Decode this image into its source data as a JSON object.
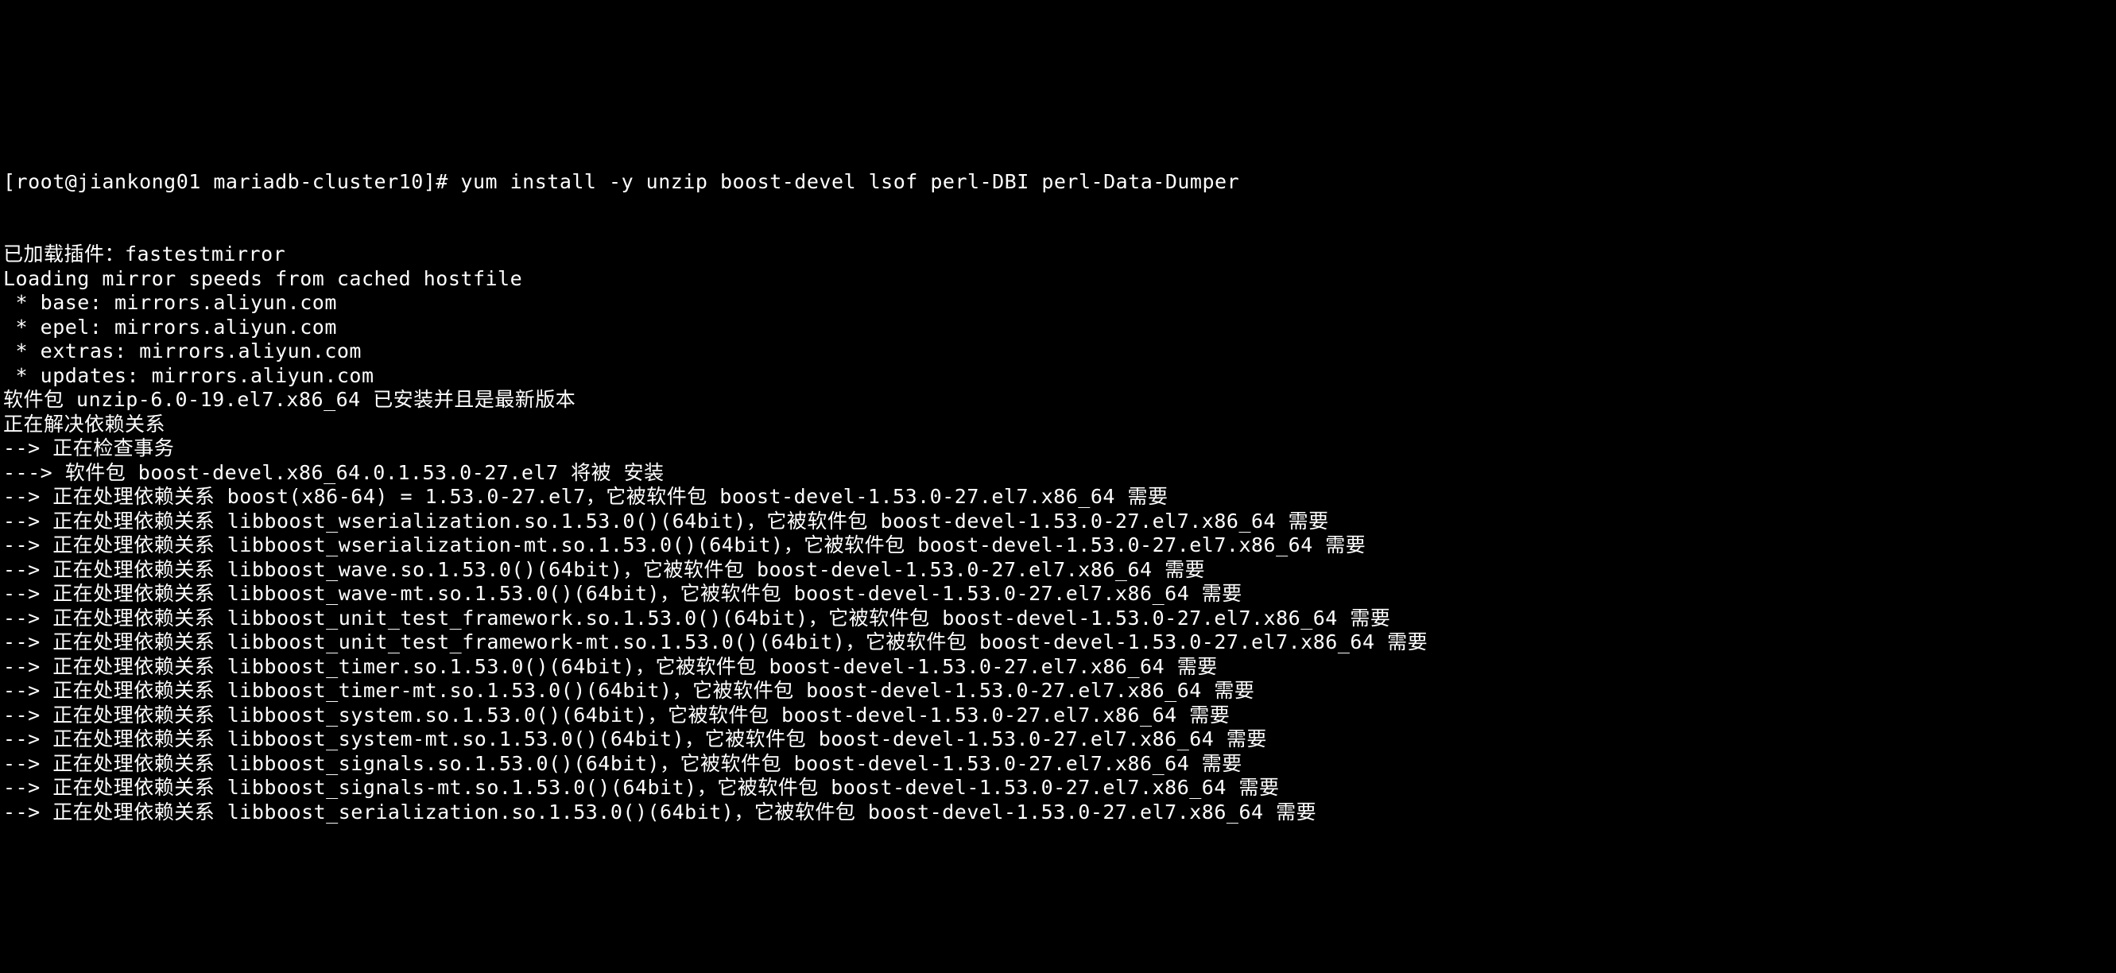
{
  "prompt_prefix": "[root@jiankong01 mariadb-cluster10]# ",
  "command": "yum install -y unzip boost-devel lsof perl-DBI perl-Data-Dumper",
  "lines": [
    "已加载插件：fastestmirror",
    "Loading mirror speeds from cached hostfile",
    " * base: mirrors.aliyun.com",
    " * epel: mirrors.aliyun.com",
    " * extras: mirrors.aliyun.com",
    " * updates: mirrors.aliyun.com",
    "软件包 unzip-6.0-19.el7.x86_64 已安装并且是最新版本",
    "正在解决依赖关系",
    "--> 正在检查事务",
    "---> 软件包 boost-devel.x86_64.0.1.53.0-27.el7 将被 安装",
    "--> 正在处理依赖关系 boost(x86-64) = 1.53.0-27.el7，它被软件包 boost-devel-1.53.0-27.el7.x86_64 需要",
    "--> 正在处理依赖关系 libboost_wserialization.so.1.53.0()(64bit)，它被软件包 boost-devel-1.53.0-27.el7.x86_64 需要",
    "--> 正在处理依赖关系 libboost_wserialization-mt.so.1.53.0()(64bit)，它被软件包 boost-devel-1.53.0-27.el7.x86_64 需要",
    "--> 正在处理依赖关系 libboost_wave.so.1.53.0()(64bit)，它被软件包 boost-devel-1.53.0-27.el7.x86_64 需要",
    "--> 正在处理依赖关系 libboost_wave-mt.so.1.53.0()(64bit)，它被软件包 boost-devel-1.53.0-27.el7.x86_64 需要",
    "--> 正在处理依赖关系 libboost_unit_test_framework.so.1.53.0()(64bit)，它被软件包 boost-devel-1.53.0-27.el7.x86_64 需要",
    "--> 正在处理依赖关系 libboost_unit_test_framework-mt.so.1.53.0()(64bit)，它被软件包 boost-devel-1.53.0-27.el7.x86_64 需要",
    "--> 正在处理依赖关系 libboost_timer.so.1.53.0()(64bit)，它被软件包 boost-devel-1.53.0-27.el7.x86_64 需要",
    "--> 正在处理依赖关系 libboost_timer-mt.so.1.53.0()(64bit)，它被软件包 boost-devel-1.53.0-27.el7.x86_64 需要",
    "--> 正在处理依赖关系 libboost_system.so.1.53.0()(64bit)，它被软件包 boost-devel-1.53.0-27.el7.x86_64 需要",
    "--> 正在处理依赖关系 libboost_system-mt.so.1.53.0()(64bit)，它被软件包 boost-devel-1.53.0-27.el7.x86_64 需要",
    "--> 正在处理依赖关系 libboost_signals.so.1.53.0()(64bit)，它被软件包 boost-devel-1.53.0-27.el7.x86_64 需要",
    "--> 正在处理依赖关系 libboost_signals-mt.so.1.53.0()(64bit)，它被软件包 boost-devel-1.53.0-27.el7.x86_64 需要",
    "--> 正在处理依赖关系 libboost_serialization.so.1.53.0()(64bit)，它被软件包 boost-devel-1.53.0-27.el7.x86_64 需要"
  ]
}
